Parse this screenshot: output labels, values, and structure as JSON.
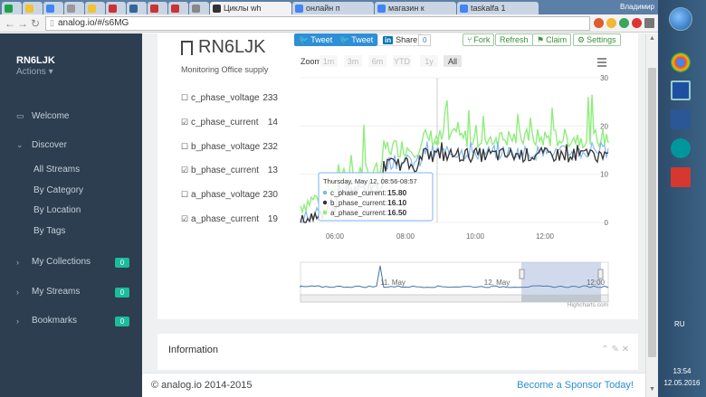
{
  "browser": {
    "tabs": [
      {
        "label": "",
        "color": "#1aa34a",
        "width": "small"
      },
      {
        "label": "",
        "color": "#f1c232",
        "width": "small"
      },
      {
        "label": "",
        "color": "#4285f4",
        "width": "small"
      },
      {
        "label": "",
        "color": "#999999",
        "width": "small"
      },
      {
        "label": "",
        "color": "#f1c232",
        "width": "small"
      },
      {
        "label": "",
        "color": "#cc3333",
        "width": "small"
      },
      {
        "label": "",
        "color": "#336699",
        "width": "small"
      },
      {
        "label": "",
        "color": "#cc3333",
        "width": "small"
      },
      {
        "label": "",
        "color": "#cc3333",
        "width": "small"
      },
      {
        "label": "",
        "color": "#888888",
        "width": "small"
      },
      {
        "label": "Циклы wh",
        "color": "#333333",
        "width": "wide",
        "active": true
      },
      {
        "label": "онлайн п",
        "color": "#4285f4",
        "width": "wide"
      },
      {
        "label": "магазин к",
        "color": "#4285f4",
        "width": "wide"
      },
      {
        "label": "taskalfa 1",
        "color": "#4285f4",
        "width": "wide"
      }
    ],
    "user": "Владимир",
    "url": "analog.io/#/s6MG"
  },
  "sidebar": {
    "brand": "RN6LJK",
    "actions": "Actions ▾",
    "welcome": "Welcome",
    "discover": "Discover",
    "sub": [
      "All Streams",
      "By Category",
      "By Location",
      "By Tags"
    ],
    "collections": "My Collections",
    "streams": "My Streams",
    "bookmarks": "Bookmarks",
    "badges": [
      "0",
      "0",
      "0"
    ]
  },
  "main": {
    "title": "RN6LJK",
    "subtitle": "Monitoring Office supply",
    "tweet1": "Tweet",
    "tweet2": "Tweet",
    "share": "Share",
    "share_count": "0",
    "fork": "Fork",
    "refresh": "Refresh",
    "claim": "Claim",
    "settings": "Settings",
    "streams": [
      {
        "name": "c_phase_voltage",
        "value": "233",
        "checked": false
      },
      {
        "name": "c_phase_current",
        "value": "14",
        "checked": true
      },
      {
        "name": "b_phase_voltage",
        "value": "232",
        "checked": false
      },
      {
        "name": "b_phase_current",
        "value": "13",
        "checked": true
      },
      {
        "name": "a_phase_voltage",
        "value": "230",
        "checked": false
      },
      {
        "name": "a_phase_current",
        "value": "19",
        "checked": true
      }
    ]
  },
  "chart_data": {
    "type": "line",
    "zoom_label": "Zoom",
    "zoom_buttons": [
      "1m",
      "3m",
      "6m",
      "YTD",
      "1y",
      "All"
    ],
    "x_ticks": [
      "06:00",
      "08:00",
      "10:00",
      "12:00"
    ],
    "y_ticks": [
      "30",
      "20",
      "10",
      "0"
    ],
    "ylim": [
      0,
      30
    ],
    "series": [
      {
        "name": "a_phase_current",
        "color": "#90ed7d"
      },
      {
        "name": "b_phase_current",
        "color": "#333333"
      },
      {
        "name": "c_phase_current",
        "color": "#7cb5ec"
      }
    ],
    "tooltip": {
      "header": "Thursday, May 12, 08:56-08:57",
      "rows": [
        {
          "label": "c_phase_current:",
          "value": "15.80",
          "color": "#7cb5ec"
        },
        {
          "label": "b_phase_current:",
          "value": "16.10",
          "color": "#333333"
        },
        {
          "label": "a_phase_current:",
          "value": "16.50",
          "color": "#90ed7d"
        }
      ]
    },
    "navigator_labels": [
      "11. May",
      "12. May",
      "12:00"
    ],
    "credits": "Highcharts.com"
  },
  "info": {
    "title": "Information"
  },
  "footer": {
    "copyright": "© analog.io 2014-2015",
    "sponsor": "Become a Sponsor Today!"
  },
  "taskbar": {
    "lang": "RU",
    "time": "13:54",
    "date": "12.05.2016"
  }
}
